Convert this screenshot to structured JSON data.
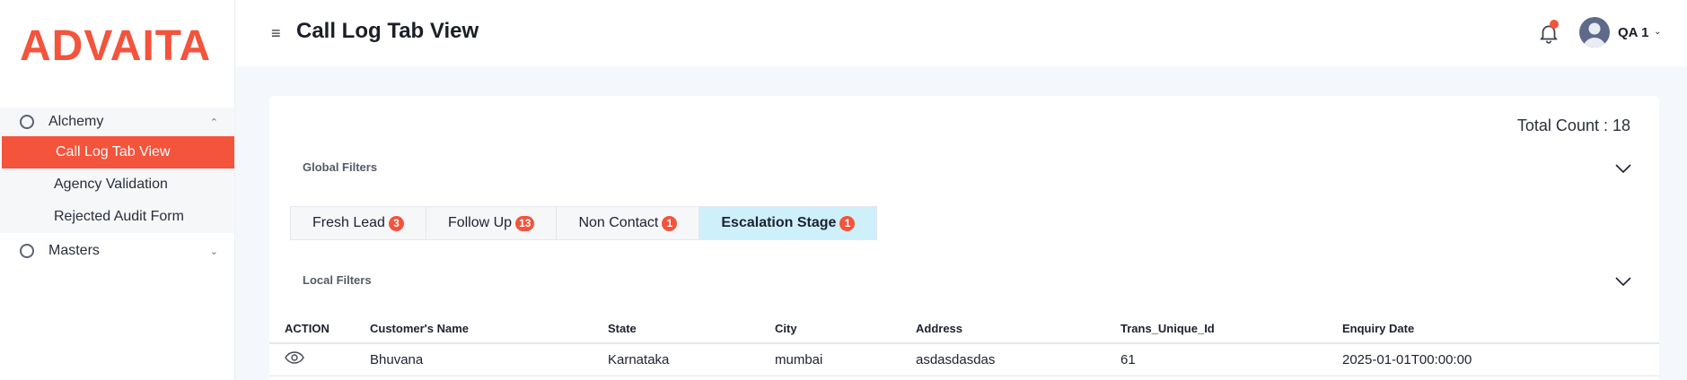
{
  "brand": {
    "logo_text": "ADVAITA",
    "accent": "#f4533c"
  },
  "sidebar": {
    "groups": [
      {
        "label": "Alchemy",
        "icon": "circle-icon",
        "expanded": true,
        "items": [
          {
            "label": "Call Log Tab View",
            "active": true
          },
          {
            "label": "Agency Validation",
            "active": false
          },
          {
            "label": "Rejected Audit Form",
            "active": false
          }
        ]
      },
      {
        "label": "Masters",
        "icon": "circle-icon",
        "expanded": false,
        "items": []
      }
    ]
  },
  "header": {
    "menu_icon": "hamburger-icon",
    "title": "Call Log Tab View",
    "notification_icon": "bell-icon",
    "user": {
      "name": "QA 1",
      "avatar_icon": "user-avatar-icon"
    }
  },
  "main": {
    "total_count_label": "Total Count : 18",
    "global_filters_label": "Global Filters",
    "local_filters_label": "Local Filters",
    "tabs": [
      {
        "label": "Fresh Lead",
        "count": "3",
        "active": false
      },
      {
        "label": "Follow Up",
        "count": "13",
        "active": false
      },
      {
        "label": "Non Contact",
        "count": "1",
        "active": false
      },
      {
        "label": "Escalation Stage",
        "count": "1",
        "active": true
      }
    ],
    "table": {
      "columns": [
        "ACTION",
        "Customer's Name",
        "State",
        "City",
        "Address",
        "Trans_Unique_Id",
        "Enquiry Date"
      ],
      "rows": [
        {
          "action_icon": "eye-icon",
          "customer": "Bhuvana",
          "state": "Karnataka",
          "city": "mumbai",
          "address": "asdasdasdas",
          "trans_id": "61",
          "enquiry_date": "2025-01-01T00:00:00"
        }
      ]
    }
  },
  "colors": {
    "active_tab_bg": "#cdf0fb",
    "badge_bg": "#f4533c",
    "page_bg": "#f4f7fb"
  }
}
